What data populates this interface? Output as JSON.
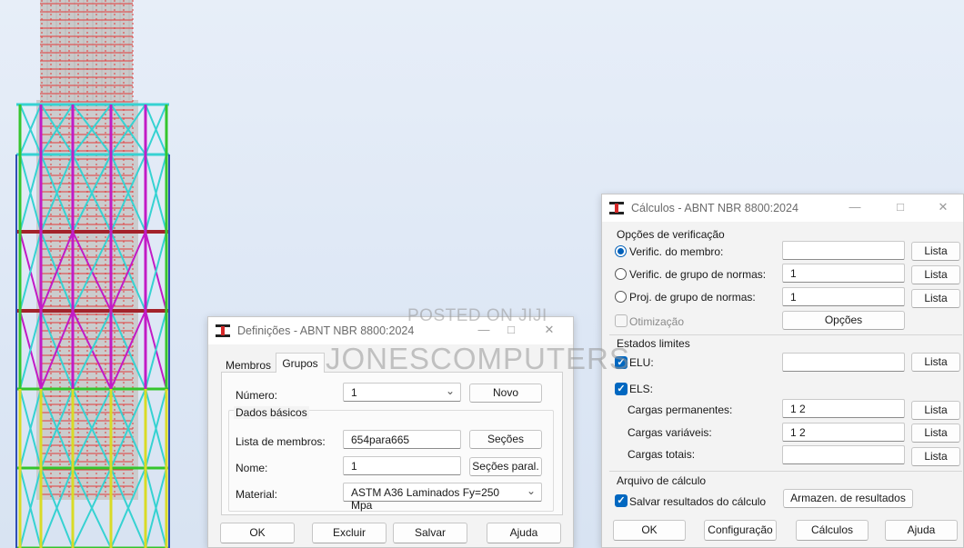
{
  "viewport": {
    "model_colors": {
      "core": "#c9c9c9",
      "node_grid": "#e23b3b",
      "ring_beam": "#a3222a",
      "cyan": "#36d2d2",
      "magenta": "#c21bc6",
      "green": "#35c52c",
      "yellow": "#d9db26",
      "blue": "#2f4fb5"
    }
  },
  "definicoes": {
    "title": "Definições - ABNT NBR 8800:2024",
    "tabs": [
      "Membros",
      "Grupos"
    ],
    "active_tab": "Grupos",
    "numero_label": "Número:",
    "numero_value": "1",
    "novo_label": "Novo",
    "dados_basicos_label": "Dados básicos",
    "lista_membros_label": "Lista de membros:",
    "lista_membros_value": "654para665",
    "secoes_label": "Seções",
    "nome_label": "Nome:",
    "nome_value": "1",
    "secoes_paral_label": "Seções paral.",
    "material_label": "Material:",
    "material_value": "ASTM A36  Laminados Fy=250 Mpa",
    "ok_label": "OK",
    "excluir_label": "Excluir",
    "salvar_label": "Salvar",
    "ajuda_label": "Ajuda",
    "min_icon": "minimize-icon",
    "max_icon": "maximize-icon",
    "close_icon": "close-icon"
  },
  "calculos": {
    "title": "Cálculos - ABNT NBR 8800:2024",
    "opcoes_verificacao_label": "Opções de verificação",
    "verific_membro_label": "Verific. do membro:",
    "verific_membro_value": "",
    "verific_grupo_label": "Verific. de grupo de normas:",
    "verific_grupo_value": "1",
    "proj_grupo_label": "Proj. de grupo de normas:",
    "proj_grupo_value": "1",
    "otimizacao_label": "Otimização",
    "opcoes_label": "Opções",
    "lista_label": "Lista",
    "estados_limites_label": "Estados limites",
    "elu_label": "ELU:",
    "elu_value": "",
    "els_label": "ELS:",
    "cargas_permanentes_label": "Cargas permanentes:",
    "cargas_permanentes_value": "1 2",
    "cargas_variaveis_label": "Cargas variáveis:",
    "cargas_variaveis_value": "1 2",
    "cargas_totais_label": "Cargas totais:",
    "cargas_totais_value": "",
    "arquivo_calculo_label": "Arquivo de cálculo",
    "salvar_resultados_label": "Salvar resultados do cálculo",
    "armazen_resultados_label": "Armazen. de resultados",
    "ok_label": "OK",
    "configuracao_label": "Configuração",
    "calculos_label": "Cálculos",
    "ajuda_label": "Ajuda",
    "selected_mode": "verific_membro",
    "elu_checked": true,
    "els_checked": true,
    "salvar_checked": true,
    "otimizacao_checked": false,
    "close_icon": "close-icon"
  },
  "watermark": {
    "line1": "POSTED ON JIJI",
    "line2": "JONESCOMPUTERS"
  }
}
